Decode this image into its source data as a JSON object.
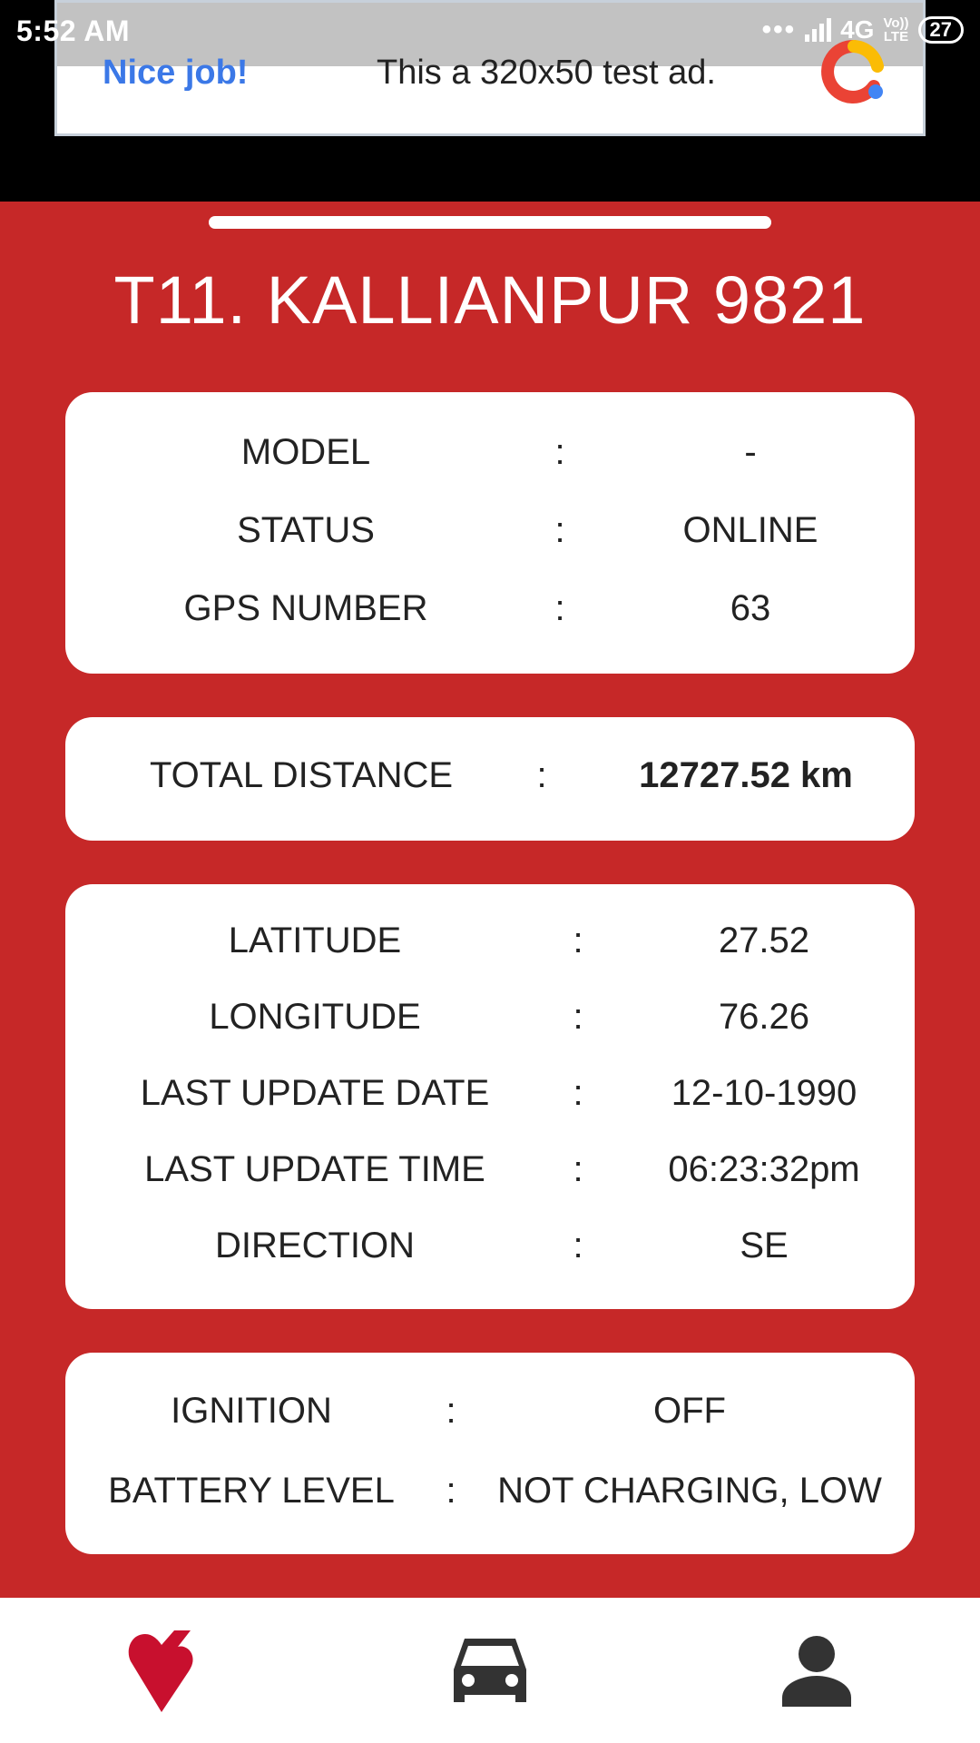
{
  "status_bar": {
    "time": "5:52 AM",
    "network": "4G",
    "volte_top": "Vo))",
    "volte_bottom": "LTE",
    "battery": "27"
  },
  "ad": {
    "nice_label": "Nice job!",
    "text": "This a 320x50 test ad."
  },
  "vehicle": {
    "title": "T11. KALLIANPUR 9821"
  },
  "card_vehicle": [
    {
      "label": "MODEL",
      "sep": ":",
      "value": "-"
    },
    {
      "label": "STATUS",
      "sep": ":",
      "value": "ONLINE"
    },
    {
      "label": "GPS NUMBER",
      "sep": ":",
      "value": "63"
    }
  ],
  "card_distance": {
    "label": "TOTAL DISTANCE",
    "sep": ":",
    "value": "12727.52 km"
  },
  "card_location": [
    {
      "label": "LATITUDE",
      "sep": ":",
      "value": "27.52"
    },
    {
      "label": "LONGITUDE",
      "sep": ":",
      "value": "76.26"
    },
    {
      "label": "LAST UPDATE DATE",
      "sep": ":",
      "value": "12-10-1990"
    },
    {
      "label": "LAST UPDATE TIME",
      "sep": ":",
      "value": "06:23:32pm"
    },
    {
      "label": "DIRECTION",
      "sep": ":",
      "value": "SE"
    }
  ],
  "card_power": [
    {
      "label": "IGNITION",
      "sep": ":",
      "value": "OFF"
    },
    {
      "label": "BATTERY LEVEL",
      "sep": ":",
      "value": "NOT CHARGING, LOW"
    }
  ],
  "nav": {
    "items": [
      {
        "icon": "heart-location-icon",
        "active": true
      },
      {
        "icon": "car-icon",
        "active": false
      },
      {
        "icon": "person-icon",
        "active": false
      }
    ]
  },
  "colors": {
    "accent": "#c62828",
    "nav_active": "#c8102e",
    "nav_inactive": "#333333"
  }
}
